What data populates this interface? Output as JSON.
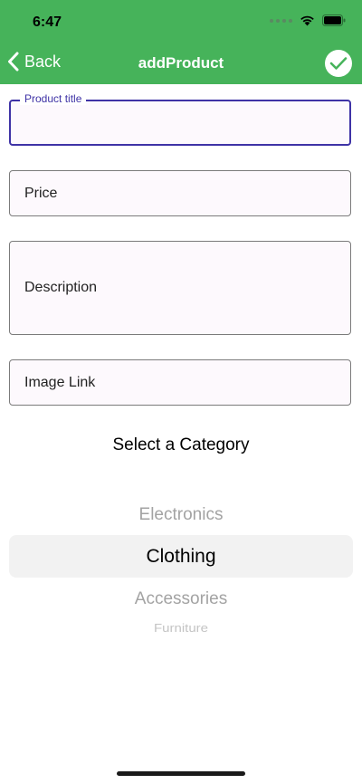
{
  "status_bar": {
    "time": "6:47"
  },
  "nav": {
    "back_label": "Back",
    "title": "addProduct"
  },
  "form": {
    "title_label": "Product title",
    "title_value": "",
    "price_placeholder": "Price",
    "description_placeholder": "Description",
    "image_placeholder": "Image Link"
  },
  "category": {
    "heading": "Select a Category",
    "options": [
      "Electronics",
      "Clothing",
      "Accessories",
      "Furniture"
    ],
    "selected": "Clothing"
  },
  "colors": {
    "header": "#46b35a",
    "focus": "#3f33a6",
    "field_background": "#fdf9fd"
  },
  "icons": [
    "chevron-left-icon",
    "checkmark-icon",
    "wifi-icon",
    "battery-icon",
    "signal-icon"
  ]
}
